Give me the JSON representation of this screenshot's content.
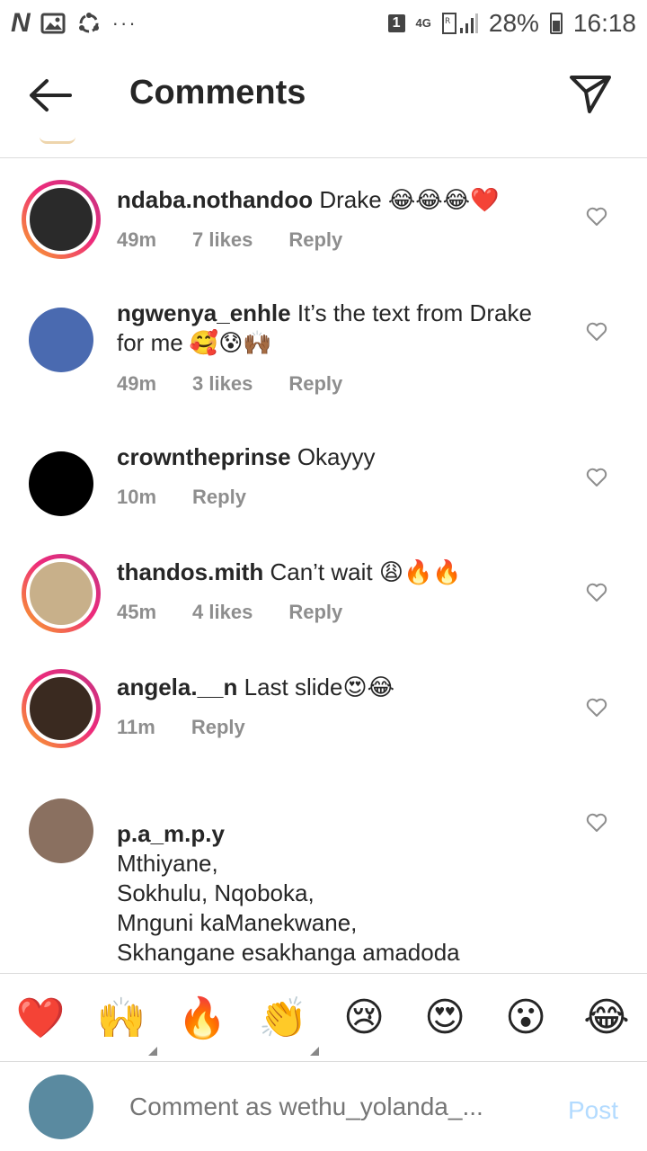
{
  "status_bar": {
    "left_glyph": "N",
    "more": "···",
    "sim": "1",
    "network": "4G",
    "battery": "28%",
    "time": "16:18"
  },
  "header": {
    "title": "Comments",
    "back_icon": "arrow-left-icon",
    "send_icon": "paper-plane-icon"
  },
  "comments": [
    {
      "username": "ndaba.nothandoo",
      "text": "Drake 😂😂😂❤️",
      "time": "49m",
      "likes": "7 likes",
      "reply": "Reply",
      "story_ring": true,
      "avatar_color": "#2a2a2a"
    },
    {
      "username": "ngwenya_enhle",
      "text": "It’s the text from Drake for me 🥰😰🙌🏾",
      "time": "49m",
      "likes": "3 likes",
      "reply": "Reply",
      "story_ring": false,
      "avatar_color": "#4a6ab0"
    },
    {
      "username": "crowntheprinse",
      "text": "Okayyy",
      "time": "10m",
      "likes": "",
      "reply": "Reply",
      "story_ring": false,
      "avatar_color": "#000000"
    },
    {
      "username": "thandos.mith",
      "text": "Can’t wait 😩🔥🔥",
      "time": "45m",
      "likes": "4 likes",
      "reply": "Reply",
      "story_ring": true,
      "avatar_color": "#c8b08a"
    },
    {
      "username": "angela.__n",
      "text": "Last slide😍😂",
      "time": "11m",
      "likes": "",
      "reply": "Reply",
      "story_ring": true,
      "avatar_color": "#3a2a20"
    },
    {
      "username": "p.a_m.p.y",
      "text": "Mthiyane,\nSokhulu, Nqoboka,\nMnguni kaManekwane,\nSkhangane esakhanga amadoda\nLuvuno, Sokotshane\nMzwili! Awuuu ezase Mzini❤️🙌🏾",
      "time": "",
      "likes": "",
      "reply": "",
      "story_ring": false,
      "avatar_color": "#8a7060"
    }
  ],
  "reactions": [
    "❤️",
    "🙌",
    "🔥",
    "👏",
    "😢",
    "😍",
    "😮",
    "😂"
  ],
  "composer": {
    "placeholder": "Comment as wethu_yolanda_...",
    "post_label": "Post",
    "avatar_color": "#5a8aa0"
  },
  "colors": {
    "meta": "#8e8e8e",
    "divider": "#dbdbdb",
    "post": "#b3dbff",
    "story_ring": "#ee2a7b"
  }
}
